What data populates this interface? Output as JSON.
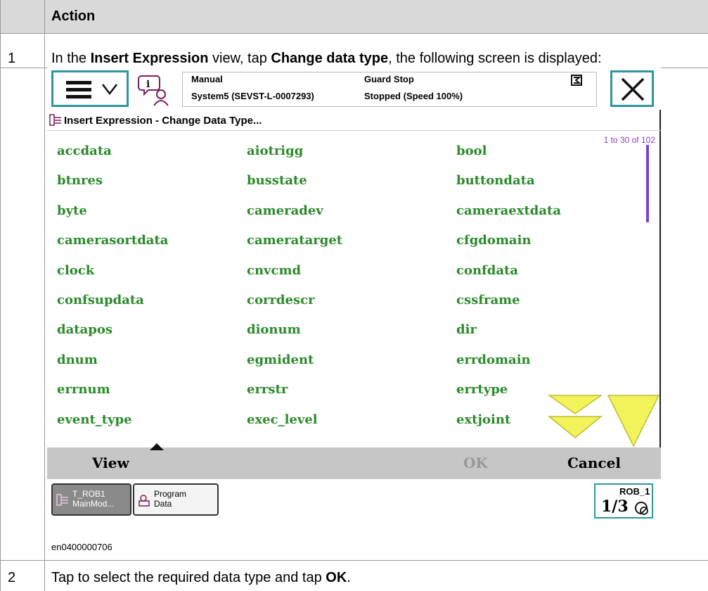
{
  "table": {
    "header": "Action",
    "steps": [
      {
        "num": "1",
        "text_pre": "In the ",
        "text_b1": "Insert Expression",
        "text_mid": " view, tap ",
        "text_b2": "Change data type",
        "text_post": ", the following screen is displayed:"
      },
      {
        "num": "2",
        "text_pre": "Tap to select the required data type and tap ",
        "text_b1": "OK",
        "text_post": "."
      }
    ],
    "figure_id": "en0400000706"
  },
  "flexpendant": {
    "status": {
      "mode": "Manual",
      "system": "System5 (SEVST-L-0007293)",
      "stop": "Guard Stop",
      "state": "Stopped (Speed 100%)"
    },
    "title": "Insert Expression - Change Data Type...",
    "counter": "1 to 30 of 102",
    "items": [
      [
        "accdata",
        "aiotrigg",
        "bool"
      ],
      [
        "btnres",
        "busstate",
        "buttondata"
      ],
      [
        "byte",
        "cameradev",
        "cameraextdata"
      ],
      [
        "camerasortdata",
        "cameratarget",
        "cfgdomain"
      ],
      [
        "clock",
        "cnvcmd",
        "confdata"
      ],
      [
        "confsupdata",
        "corrdescr",
        "cssframe"
      ],
      [
        "datapos",
        "dionum",
        "dir"
      ],
      [
        "dnum",
        "egmident",
        "errdomain"
      ],
      [
        "errnum",
        "errstr",
        "errtype"
      ],
      [
        "event_type",
        "exec_level",
        "extjoint"
      ]
    ],
    "commands": {
      "view": "View",
      "ok": "OK",
      "cancel": "Cancel"
    },
    "tasks": [
      {
        "label": "T_ROB1\nMainMod..."
      },
      {
        "label": "Program\nData"
      }
    ],
    "rob": {
      "name": "ROB_1",
      "fraction": "1/3"
    },
    "colors": {
      "accent": "#2f97a0",
      "item_text": "#2a8a2a",
      "scroll": "#7b3fcf",
      "scroll_button": "#f2f25a"
    }
  }
}
